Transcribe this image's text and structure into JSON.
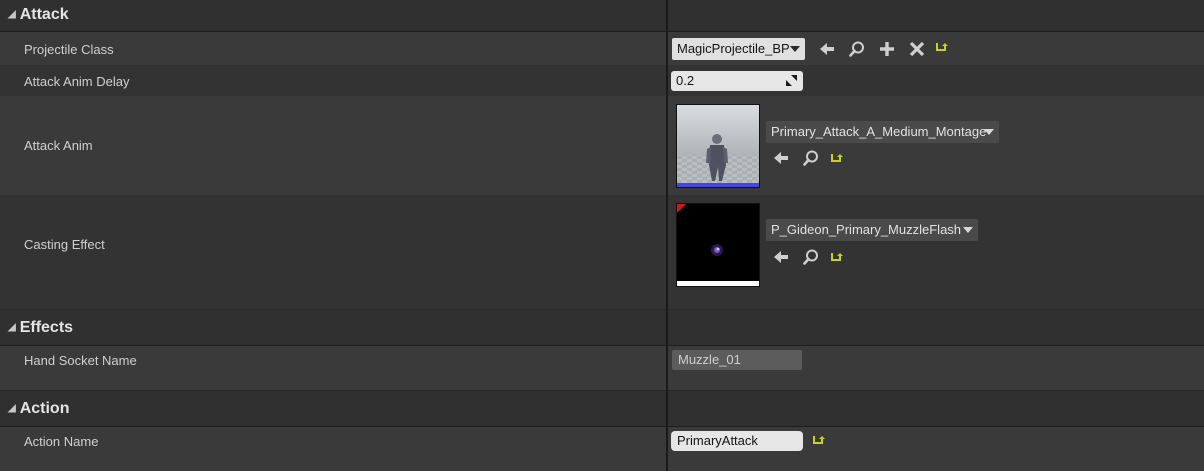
{
  "sections": {
    "attack": {
      "title": "Attack"
    },
    "effects": {
      "title": "Effects"
    },
    "action": {
      "title": "Action"
    }
  },
  "projectile_class": {
    "label": "Projectile Class",
    "value": "MagicProjectile_BP"
  },
  "attack_anim_delay": {
    "label": "Attack Anim Delay",
    "value": "0.2"
  },
  "attack_anim": {
    "label": "Attack Anim",
    "value": "Primary_Attack_A_Medium_Montage"
  },
  "casting_effect": {
    "label": "Casting Effect",
    "value": "P_Gideon_Primary_MuzzleFlash"
  },
  "hand_socket_name": {
    "label": "Hand Socket Name",
    "value": "Muzzle_01"
  },
  "action_name": {
    "label": "Action Name",
    "value": "PrimaryAttack"
  },
  "colors": {
    "reset_arrow": "#c8d21e",
    "thumb_border_anim": "#4646e6",
    "thumb_border_effect": "#ffffff",
    "corner_flag": "#d01818"
  },
  "icons": {
    "browse": "arrow-left-icon",
    "find": "magnifier-icon",
    "add": "plus-icon",
    "clear": "x-icon",
    "reset": "reset-arrow-icon",
    "collapse": "triangle-down-icon"
  }
}
